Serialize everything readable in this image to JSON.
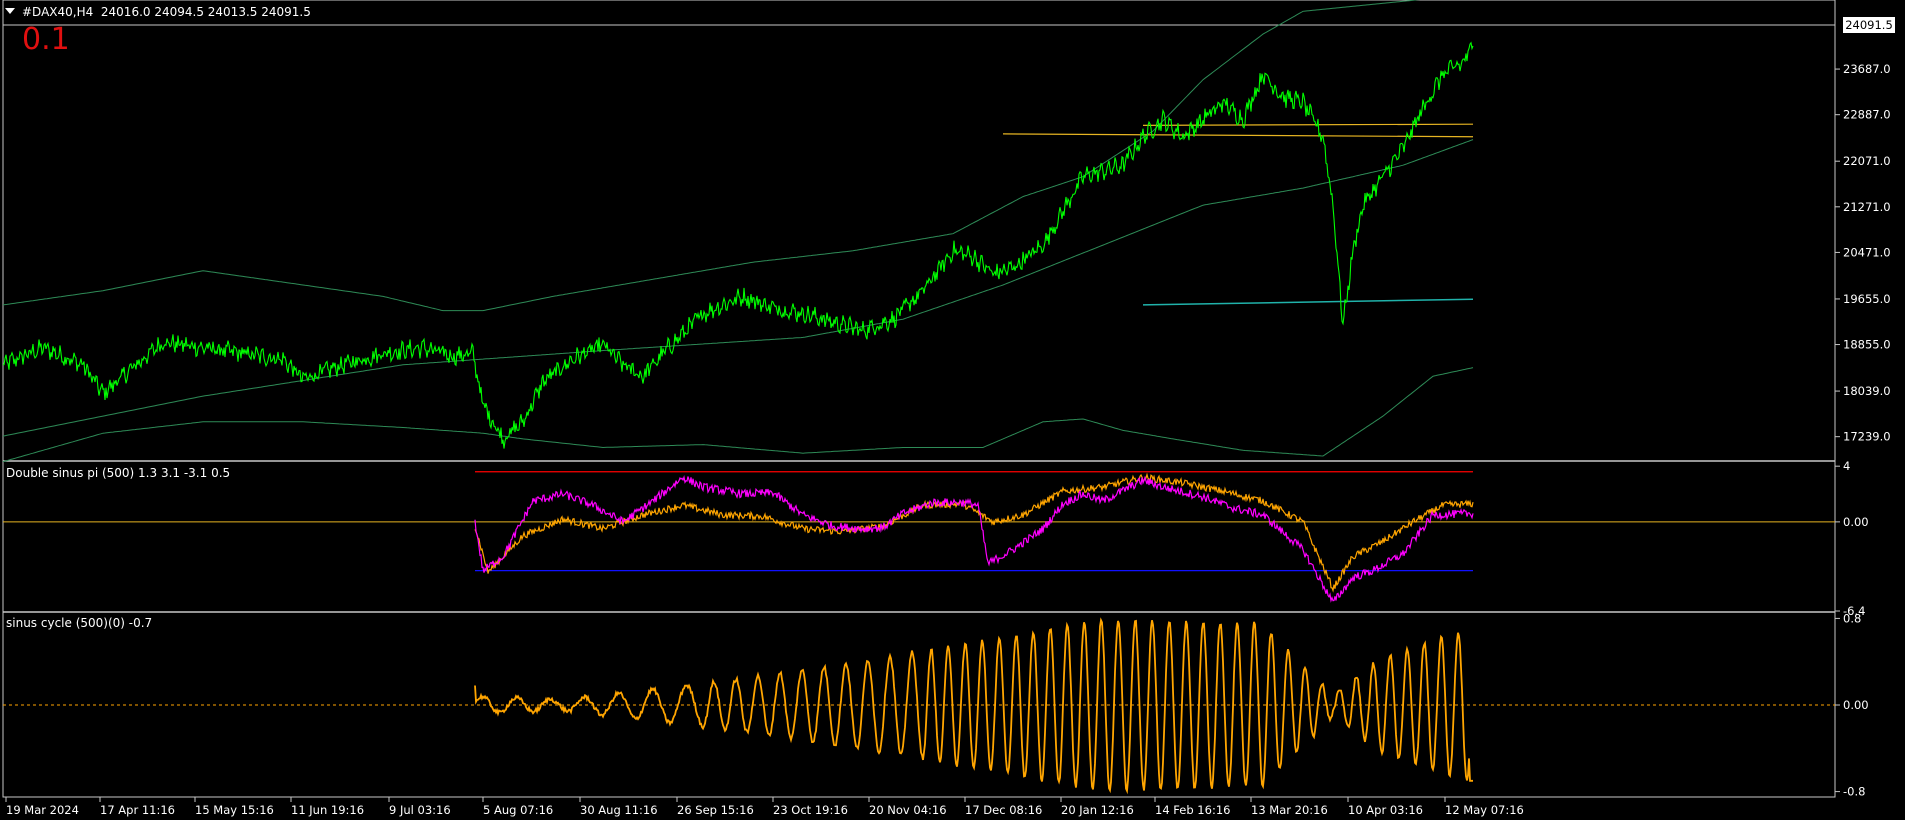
{
  "main_panel": {
    "symbol": "#DAX40,H4",
    "ohlc": "24016.0 24094.5 24013.5 24091.5",
    "big_value": "0.1",
    "current_price_label": "24091.5",
    "price_labels": [
      "23687.0",
      "22887.0",
      "22071.0",
      "21271.0",
      "20471.0",
      "19655.0",
      "18855.0",
      "18039.0",
      "17239.0"
    ]
  },
  "panel_2": {
    "title": "Double sinus pi (500) 1.3 3.1 -3.1 0.5",
    "labels": [
      "4",
      "0.00",
      "-6.4"
    ]
  },
  "panel_3": {
    "title": "sinus cycle (500)(0) -0.7",
    "labels": [
      "0.8",
      "0.00",
      "-0.8"
    ]
  },
  "time_labels": [
    "19 Mar 2024",
    "17 Apr 11:16",
    "15 May 15:16",
    "11 Jun 19:16",
    "9 Jul 03:16",
    "5 Aug 07:16",
    "30 Aug 11:16",
    "26 Sep 15:16",
    "23 Oct 19:16",
    "20 Nov 04:16",
    "17 Dec 08:16",
    "20 Jan 12:16",
    "14 Feb 16:16",
    "13 Mar 20:16",
    "10 Apr 03:16",
    "12 May 07:16"
  ],
  "colors": {
    "price": "#00ff00",
    "envelope": "#2e8b57",
    "midline": "#2e8b57",
    "yellow_level": "#e6b422",
    "cyan_level": "#20b2aa",
    "ds_upper": "#ff0000",
    "ds_lower": "#1010ff",
    "ds_zero": "#e6b422",
    "ds_line1": "#ff00ff",
    "ds_line2": "#ffa500",
    "sinus": "#ffa500"
  },
  "chart_data": [
    {
      "type": "line",
      "title": "#DAX40,H4",
      "ylim": [
        16830,
        24460
      ],
      "x_range": [
        0,
        1470
      ],
      "series": [
        {
          "values_keypoints": [
            [
              0,
              18500
            ],
            [
              40,
              18800
            ],
            [
              80,
              18500
            ],
            [
              100,
              18000
            ],
            [
              120,
              18300
            ],
            [
              160,
              18900
            ],
            [
              200,
              18800
            ],
            [
              240,
              18700
            ],
            [
              280,
              18600
            ],
            [
              300,
              18250
            ],
            [
              340,
              18500
            ],
            [
              380,
              18700
            ],
            [
              420,
              18800
            ],
            [
              450,
              18650
            ],
            [
              470,
              18700
            ],
            [
              480,
              17800
            ],
            [
              500,
              17200
            ],
            [
              520,
              17500
            ],
            [
              540,
              18200
            ],
            [
              570,
              18600
            ],
            [
              600,
              18850
            ],
            [
              620,
              18500
            ],
            [
              640,
              18300
            ],
            [
              660,
              18700
            ],
            [
              700,
              19400
            ],
            [
              740,
              19700
            ],
            [
              770,
              19500
            ],
            [
              800,
              19400
            ],
            [
              830,
              19250
            ],
            [
              860,
              19100
            ],
            [
              890,
              19300
            ],
            [
              920,
              19800
            ],
            [
              950,
              20500
            ],
            [
              970,
              20400
            ],
            [
              990,
              20100
            ],
            [
              1010,
              20200
            ],
            [
              1040,
              20600
            ],
            [
              1060,
              21200
            ],
            [
              1080,
              21800
            ],
            [
              1100,
              21900
            ],
            [
              1120,
              22000
            ],
            [
              1140,
              22500
            ],
            [
              1160,
              22800
            ],
            [
              1180,
              22500
            ],
            [
              1200,
              22800
            ],
            [
              1220,
              23100
            ],
            [
              1240,
              22800
            ],
            [
              1260,
              23600
            ],
            [
              1280,
              23200
            ],
            [
              1300,
              23100
            ],
            [
              1320,
              22500
            ],
            [
              1330,
              21300
            ],
            [
              1340,
              19200
            ],
            [
              1350,
              20500
            ],
            [
              1360,
              21300
            ],
            [
              1380,
              21800
            ],
            [
              1400,
              22300
            ],
            [
              1420,
              23000
            ],
            [
              1440,
              23600
            ],
            [
              1460,
              23800
            ],
            [
              1470,
              24091
            ]
          ]
        }
      ]
    },
    {
      "type": "line",
      "title": "Double sinus pi (500) 1.3 3.1 -3.1 0.5",
      "ylim": [
        -6.4,
        4
      ],
      "levels": [
        3.6,
        0,
        -3.5
      ],
      "series": [
        {
          "values_keypoints": [
            [
              472,
              0
            ],
            [
              480,
              -3.5
            ],
            [
              500,
              -2.5
            ],
            [
              530,
              1.5
            ],
            [
              560,
              2.0
            ],
            [
              590,
              1.2
            ],
            [
              620,
              0
            ],
            [
              650,
              1.5
            ],
            [
              680,
              3.2
            ],
            [
              700,
              2.5
            ],
            [
              740,
              2.0
            ],
            [
              770,
              2.1
            ],
            [
              800,
              0.5
            ],
            [
              830,
              -0.3
            ],
            [
              860,
              -0.5
            ],
            [
              880,
              -0.4
            ],
            [
              900,
              0.6
            ],
            [
              930,
              1.4
            ],
            [
              960,
              1.4
            ],
            [
              975,
              1.2
            ],
            [
              985,
              -3.0
            ],
            [
              1010,
              -2.0
            ],
            [
              1040,
              -0.5
            ],
            [
              1060,
              1.3
            ],
            [
              1080,
              2.0
            ],
            [
              1100,
              1.5
            ],
            [
              1140,
              3.0
            ],
            [
              1160,
              2.5
            ],
            [
              1200,
              1.8
            ],
            [
              1230,
              1.0
            ],
            [
              1260,
              0.5
            ],
            [
              1300,
              -2.0
            ],
            [
              1330,
              -5.8
            ],
            [
              1350,
              -4.0
            ],
            [
              1370,
              -3.5
            ],
            [
              1400,
              -2.3
            ],
            [
              1430,
              0.5
            ],
            [
              1470,
              0.6
            ]
          ]
        },
        {
          "values_keypoints": [
            [
              472,
              -0.3
            ],
            [
              485,
              -3.6
            ],
            [
              520,
              -1.0
            ],
            [
              560,
              0.2
            ],
            [
              600,
              -0.5
            ],
            [
              640,
              0.5
            ],
            [
              680,
              1.2
            ],
            [
              720,
              0.5
            ],
            [
              760,
              0.4
            ],
            [
              800,
              -0.5
            ],
            [
              840,
              -0.7
            ],
            [
              880,
              -0.3
            ],
            [
              920,
              1.2
            ],
            [
              960,
              1.3
            ],
            [
              990,
              0
            ],
            [
              1020,
              0.5
            ],
            [
              1060,
              2.2
            ],
            [
              1100,
              2.5
            ],
            [
              1140,
              3.2
            ],
            [
              1180,
              2.8
            ],
            [
              1220,
              2.2
            ],
            [
              1260,
              1.5
            ],
            [
              1300,
              0
            ],
            [
              1330,
              -4.8
            ],
            [
              1350,
              -2.5
            ],
            [
              1380,
              -1.4
            ],
            [
              1410,
              0
            ],
            [
              1440,
              1.2
            ],
            [
              1470,
              1.3
            ]
          ]
        }
      ]
    },
    {
      "type": "line",
      "title": "sinus cycle (500)(0) -0.7",
      "ylim": [
        -0.8,
        0.8
      ],
      "series": [
        {
          "name": "sinus cycle",
          "amplitude_keypoints": [
            [
              472,
              0.08
            ],
            [
              560,
              0.05
            ],
            [
              700,
              0.2
            ],
            [
              820,
              0.35
            ],
            [
              920,
              0.5
            ],
            [
              1100,
              0.8
            ],
            [
              1260,
              0.75
            ],
            [
              1330,
              0.1
            ],
            [
              1380,
              0.45
            ],
            [
              1470,
              0.72
            ]
          ],
          "last_value": -0.7
        }
      ]
    }
  ]
}
